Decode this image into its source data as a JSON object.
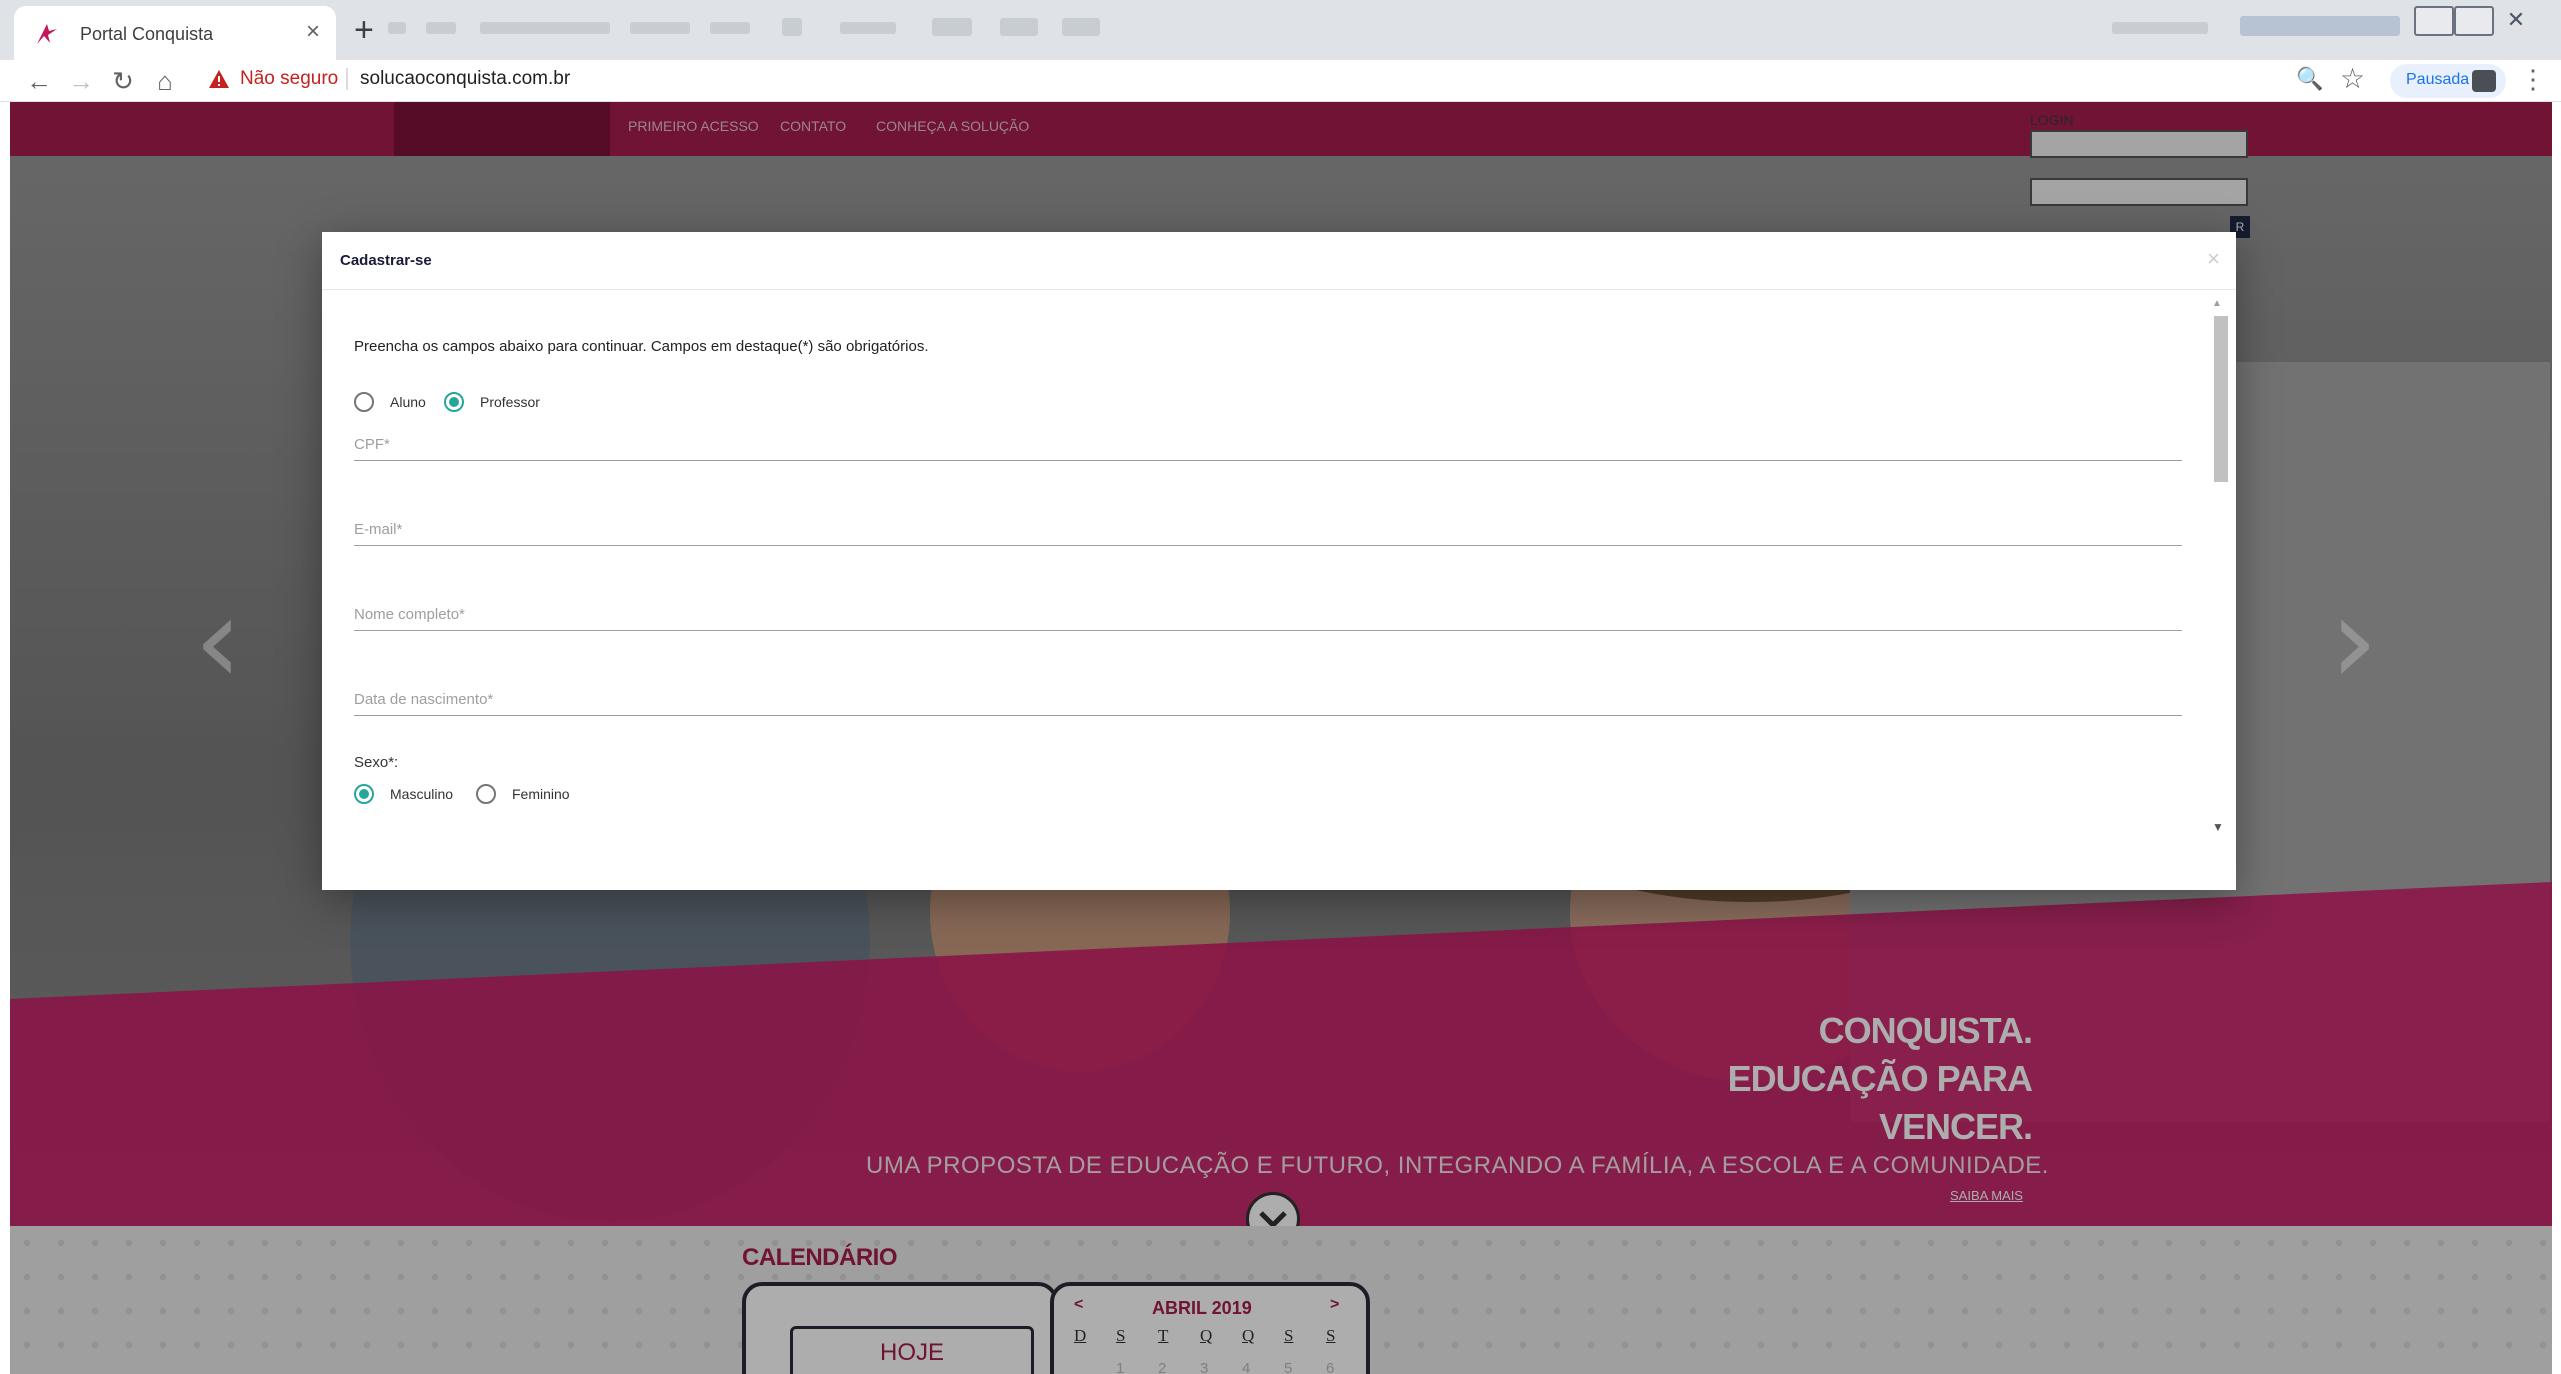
{
  "browser": {
    "tab_title": "Portal Conquista",
    "tab_close": "×",
    "new_tab": "+",
    "back": "←",
    "forward": "→",
    "reload": "↻",
    "home": "⌂",
    "security_label": "Não seguro",
    "url": "solucaoconquista.com.br",
    "zoom_glyph": "🔍",
    "star_glyph": "☆",
    "profile_label": "Pausada",
    "menu_glyph": "⋮"
  },
  "site": {
    "nav": [
      "PRIMEIRO ACESSO",
      "CONTATO",
      "CONHEÇA A SOLUÇÃO"
    ],
    "login_label": "LOGIN",
    "login_btn": "R",
    "slide_prev": "‹",
    "slide_next": "›",
    "hero_line1": "CONQUISTA.",
    "hero_line2": "EDUCAÇÃO PARA",
    "hero_line3": "VENCER.",
    "hero_tagline": "UMA PROPOSTA DE EDUCAÇÃO E FUTURO, INTEGRANDO A FAMÍLIA, A ESCOLA E A COMUNIDADE.",
    "saiba_mais": "SAIBA MAIS",
    "scroll_glyph": "⌄",
    "calendar": {
      "title": "CALENDÁRIO",
      "today_label": "HOJE",
      "prev": "<",
      "next": ">",
      "month": "ABRIL 2019",
      "weekdays": [
        "D",
        "S",
        "T",
        "Q",
        "Q",
        "S",
        "S"
      ],
      "days": [
        "1",
        "2",
        "3",
        "4",
        "5",
        "6"
      ]
    },
    "brand_color": "#a51d4e"
  },
  "modal": {
    "title": "Cadastrar-se",
    "close": "×",
    "instructions": "Preencha os campos abaixo para continuar. Campos em destaque(*) são obrigatórios.",
    "user_types": [
      {
        "label": "Aluno",
        "checked": false
      },
      {
        "label": "Professor",
        "checked": true
      }
    ],
    "fields": {
      "cpf": "CPF*",
      "email": "E-mail*",
      "nome": "Nome completo*",
      "nascimento": "Data de nascimento*"
    },
    "sexo_label": "Sexo*:",
    "sexo_options": [
      {
        "label": "Masculino",
        "checked": true
      },
      {
        "label": "Feminino",
        "checked": false
      }
    ],
    "scroll_up": "▲",
    "scroll_down": "▼",
    "accent_color": "#26a69a"
  }
}
